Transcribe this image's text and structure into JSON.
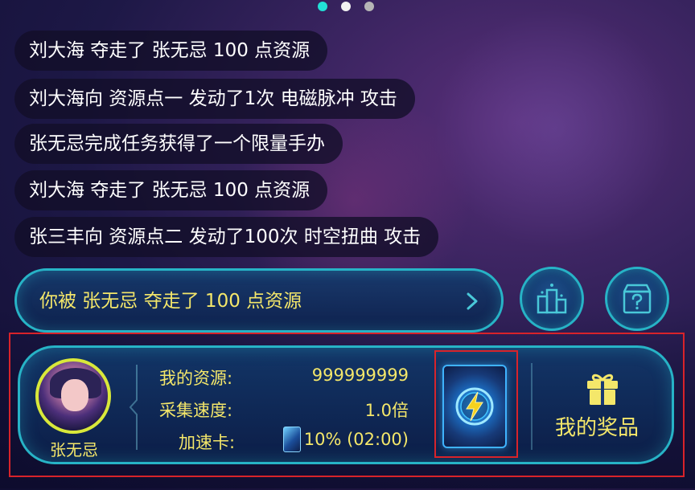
{
  "pager": {
    "count": 3,
    "active_index": 0
  },
  "feed": {
    "messages": [
      "刘大海 夺走了 张无忌 100 点资源",
      "刘大海向 资源点一 发动了1次 电磁脉冲 攻击",
      "张无忌完成任务获得了一个限量手办",
      "刘大海 夺走了 张无忌 100 点资源",
      "张三丰向 资源点二 发动了100次 时空扭曲 攻击"
    ]
  },
  "notification": {
    "text": "你被 张无忌 夺走了 100 点资源",
    "arrow_icon": "chevron-right-icon"
  },
  "buttons": {
    "ranking_icon": "podium-icon",
    "mystery_box_icon": "question-box-icon"
  },
  "player": {
    "name": "张无忌",
    "resources_label": "我的资源:",
    "resources_value": "999999999",
    "speed_label": "采集速度:",
    "speed_value": "1.0倍",
    "card_label": "加速卡:",
    "card_value": "10% (02:00)"
  },
  "prizes": {
    "label": "我的奖品",
    "icon": "gift-icon"
  },
  "colors": {
    "accent_cyan": "#27b3c6",
    "text_yellow": "#f4e76a",
    "highlight_red": "#d8232a",
    "active_dot": "#22e0d6"
  }
}
